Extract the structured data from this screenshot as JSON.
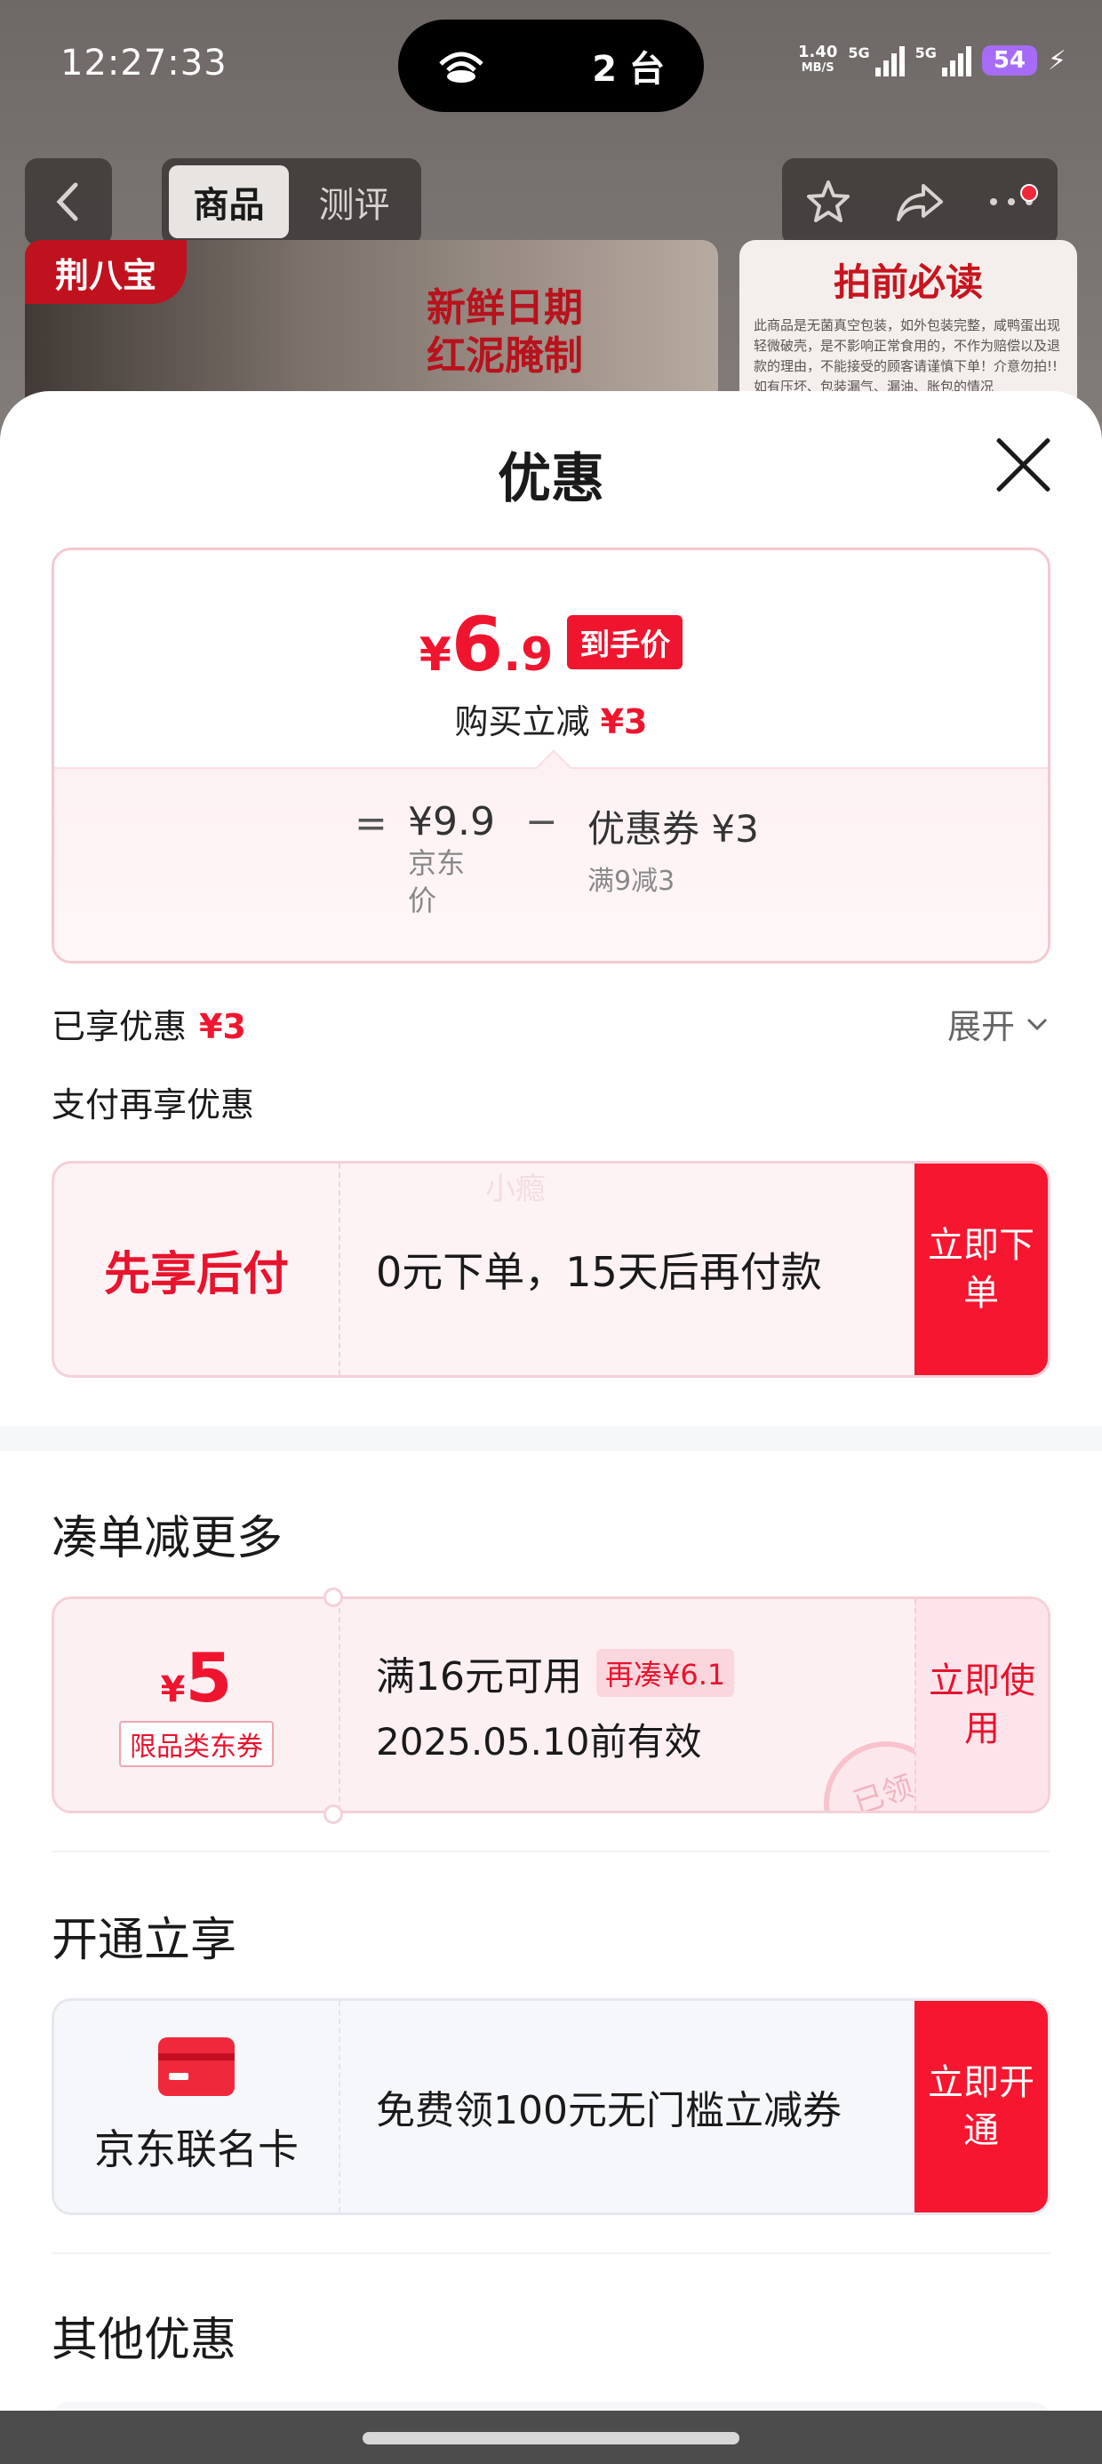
{
  "status_bar": {
    "time": "12:27:33",
    "island_text": "2 台",
    "net_speed_value": "1.40",
    "net_speed_unit": "MB/S",
    "signal1_label": "5G",
    "signal2_label": "5G",
    "battery": "54"
  },
  "nav": {
    "tabs": [
      "商品",
      "测评"
    ],
    "active_tab": "商品"
  },
  "product_banner": {
    "brand": "荆八宝",
    "headline_line1": "新鲜日期",
    "headline_line2": "红泥腌制",
    "notice_title": "拍前必读",
    "notice_body": "此商品是无菌真空包装，如外包装完整，咸鸭蛋出现轻微破壳，是不影响正常食用的，不作为赔偿以及退款的理由，不能接受的顾客请谨慎下单！介意勿拍!!如有压坏、包装漏气、漏油、胀包的情况"
  },
  "sheet": {
    "title": "优惠",
    "price_card": {
      "yen": "¥",
      "price_int": "6",
      "price_dec": ".9",
      "badge": "到手价",
      "sub_label": "购买立减",
      "sub_amount": "¥3",
      "equals": "=",
      "base_price": "¥9.9",
      "base_label": "京东价",
      "minus": "−",
      "coupon_value": "优惠券 ¥3",
      "coupon_rule": "满9减3"
    },
    "enjoyed_label": "已享优惠",
    "enjoyed_amount": "¥3",
    "expand_label": "展开",
    "pay_section_title": "支付再享优惠",
    "pay_card": {
      "left": "先享后付",
      "middle": "0元下单，15天后再付款",
      "action": "立即下单",
      "watermark": "小瘾"
    },
    "bundle_section_title": "凑单减更多",
    "coupon_card": {
      "yen": "¥",
      "amount": "5",
      "type_tag": "限品类东券",
      "condition": "满16元可用",
      "chip": "再凑¥6.1",
      "expiry": "2025.05.10前有效",
      "action": "立即使用",
      "stamp": "已领"
    },
    "member_section_title": "开通立享",
    "member_card": {
      "left": "京东联名卡",
      "middle": "免费领100元无门槛立减券",
      "action": "立即开通"
    },
    "other_section_title": "其他优惠"
  },
  "colors": {
    "accent_red": "#f0152f",
    "card_pink": "#fdf2f4"
  }
}
